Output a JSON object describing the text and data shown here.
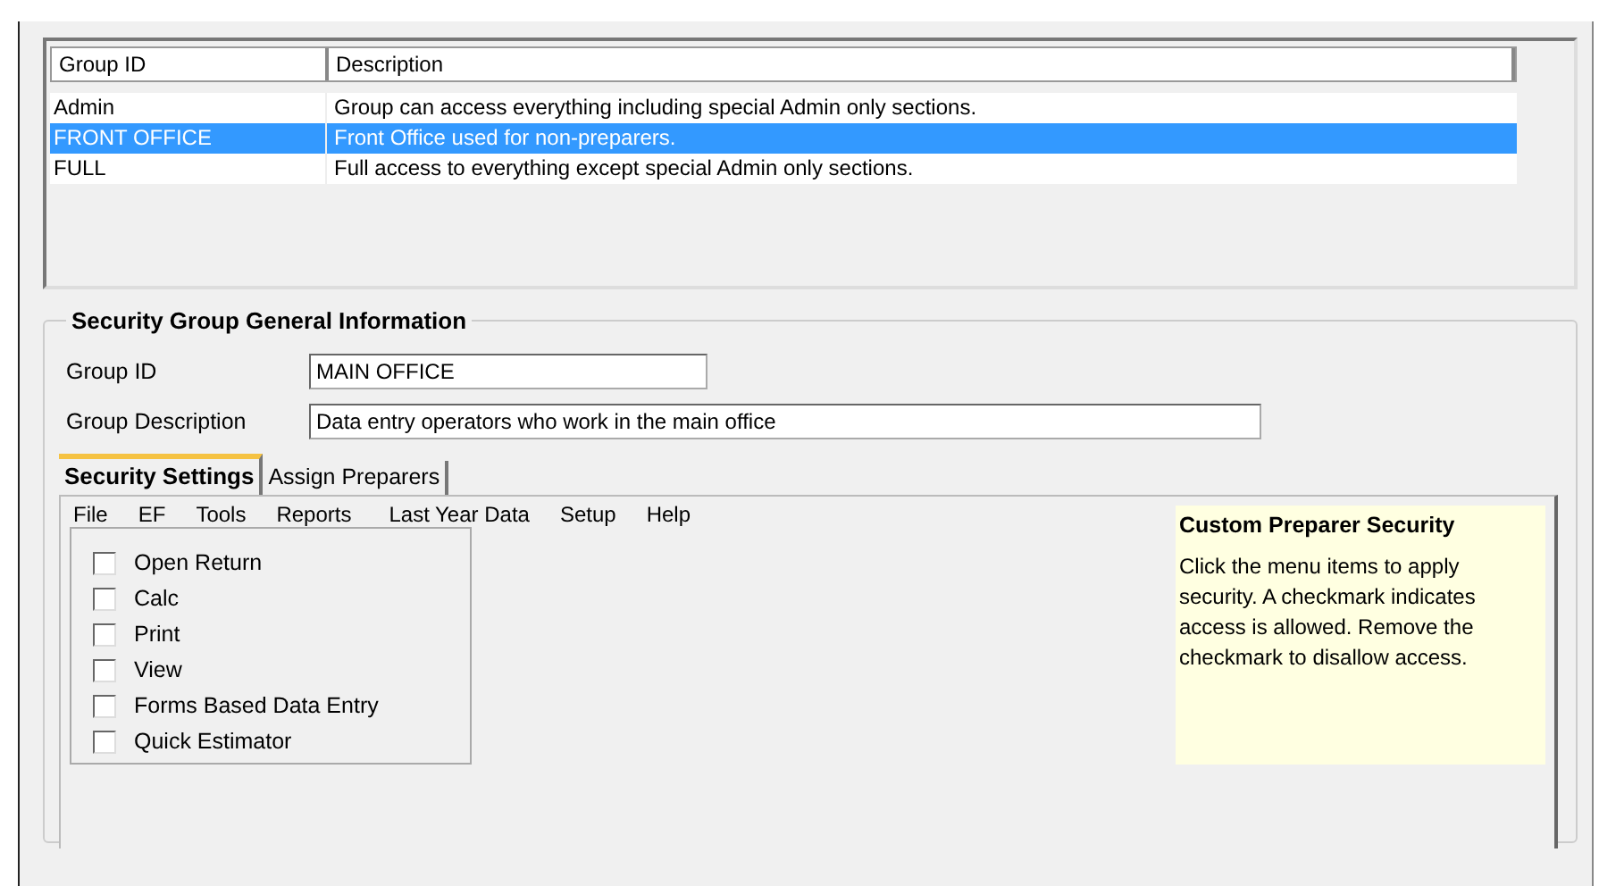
{
  "groups_table": {
    "columns": [
      "Group ID",
      "Description"
    ],
    "rows": [
      {
        "group_id": "Admin",
        "description": "Group can access everything including special Admin only sections.",
        "selected": false
      },
      {
        "group_id": "FRONT OFFICE",
        "description": "Front Office used for non-preparers.",
        "selected": true
      },
      {
        "group_id": "FULL",
        "description": "Full access to everything except special Admin only sections.",
        "selected": false
      }
    ]
  },
  "general_info": {
    "title": "Security Group General Information",
    "fields": [
      {
        "label": "Group ID",
        "value": "MAIN OFFICE",
        "kind": "short"
      },
      {
        "label": "Group Description",
        "value": "Data entry operators who work in the main office",
        "kind": "long"
      }
    ]
  },
  "tabs": [
    {
      "label": "Security Settings",
      "selected": true
    },
    {
      "label": "Assign Preparers",
      "selected": false
    }
  ],
  "menu": [
    "File",
    "EF",
    "Tools",
    "Reports",
    "Last Year Data",
    "Setup",
    "Help"
  ],
  "permissions": [
    {
      "label": "Open Return",
      "checked": false
    },
    {
      "label": "Calc",
      "checked": false
    },
    {
      "label": "Print",
      "checked": false
    },
    {
      "label": "View",
      "checked": false
    },
    {
      "label": "Forms Based  Data Entry",
      "checked": false
    },
    {
      "label": "Quick Estimator",
      "checked": false
    }
  ],
  "note": {
    "title": "Custom Preparer Security",
    "text": "Click the menu items to apply security. A checkmark indicates access is allowed. Remove the checkmark to disallow access."
  }
}
